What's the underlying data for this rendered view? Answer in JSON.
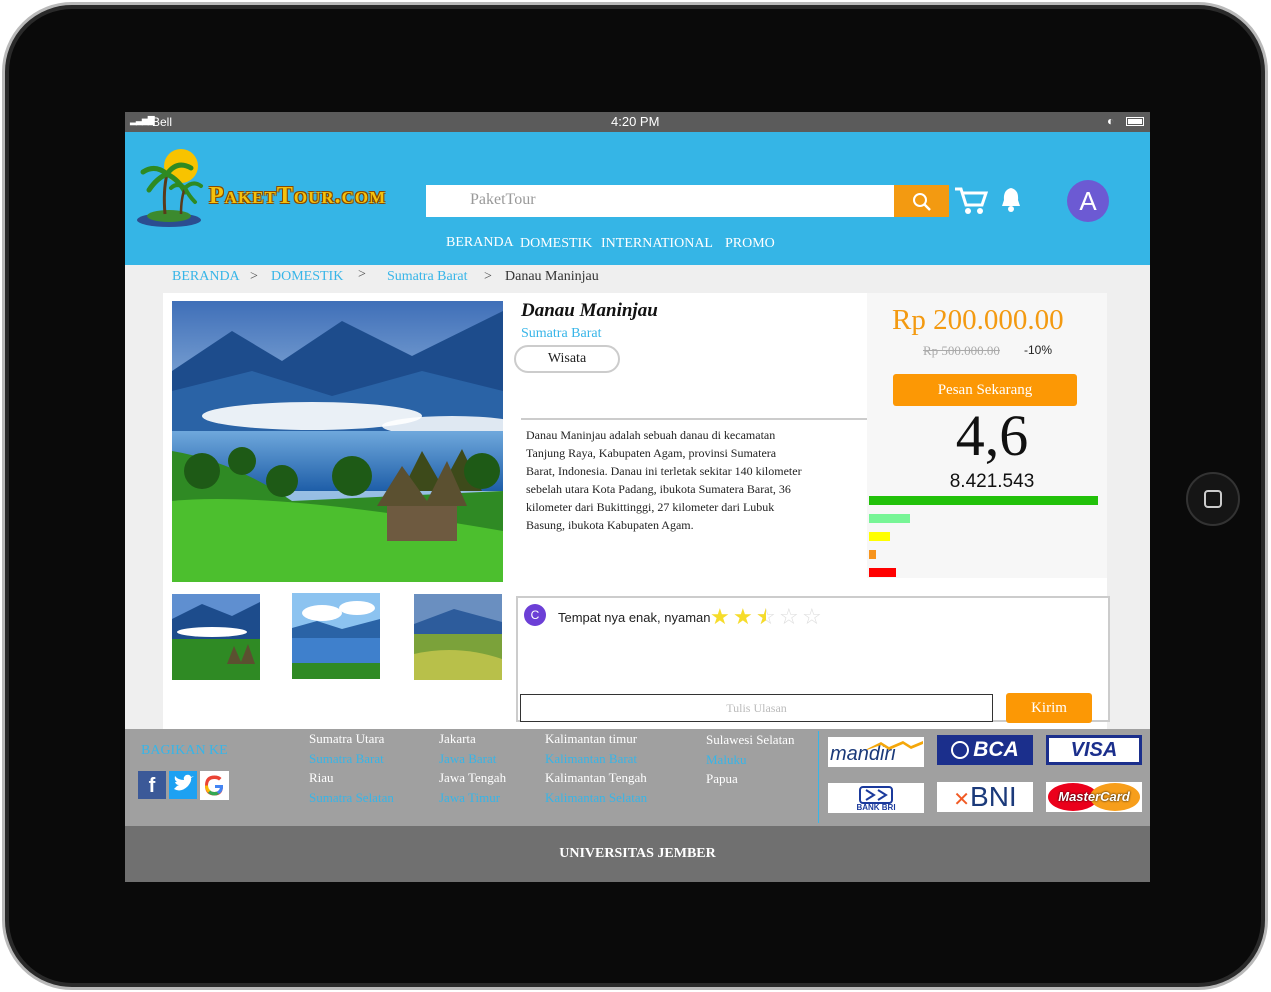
{
  "status": {
    "carrier": "Bell",
    "time": "4:20 PM"
  },
  "brand": {
    "name": "PaketTour.com"
  },
  "search": {
    "placeholder": "PaketTour"
  },
  "user": {
    "avatar_letter": "A"
  },
  "nav": [
    "BERANDA",
    "DOMESTIK",
    "INTERNATIONAL",
    "PROMO"
  ],
  "breadcrumb": [
    "BERANDA",
    ">",
    "DOMESTIK",
    ">",
    "Sumatra Barat",
    ">",
    "Danau Maninjau"
  ],
  "product": {
    "title": "Danau Maninjau",
    "region": "Sumatra Barat",
    "category": "Wisata",
    "description": "Danau Maninjau adalah sebuah danau di kecamatan Tanjung Raya, Kabupaten Agam, provinsi Sumatera Barat, Indonesia. Danau ini terletak sekitar 140 kilometer sebelah utara Kota Padang, ibukota Sumatera Barat, 36 kilometer dari Bukittinggi, 27 kilometer dari Lubuk Basung, ibukota Kabupaten Agam.",
    "price": "Rp 200.000.00",
    "old_price": "Rp 500.000.00",
    "discount": "-10%",
    "order_button": "Pesan Sekarang",
    "rating": "4,6",
    "rating_count": "8.421.543",
    "rating_bars": [
      {
        "level": 1.0,
        "color": "#22c10a"
      },
      {
        "level": 0.18,
        "color": "#77f596"
      },
      {
        "level": 0.09,
        "color": "#ffff00"
      },
      {
        "level": 0.03,
        "color": "#f7941d"
      },
      {
        "level": 0.12,
        "color": "#ff0000"
      }
    ]
  },
  "review": {
    "avatar_letter": "C",
    "text": "Tempat nya enak, nyaman",
    "stars": 2.5,
    "stars_max": 5,
    "input_placeholder": "Tulis Ulasan",
    "submit_label": "Kirim"
  },
  "footer": {
    "share_label": "BAGIKAN KE",
    "columns": [
      [
        "Sumatra Utara",
        "Sumatra Barat",
        "Riau",
        "Sumatra Selatan"
      ],
      [
        "Jakarta",
        "Jawa Barat",
        "Jawa Tengah",
        "Jawa Timur"
      ],
      [
        "Kalimantan timur",
        "Kalimantan Barat",
        "Kalimantan Tengah",
        "Kalimantan Selatan"
      ],
      [
        "Sulawesi Selatan",
        "Maluku",
        "Papua"
      ]
    ],
    "payments": [
      "mandiri",
      "BCA",
      "VISA",
      "BANK BRI",
      "BNI",
      "MasterCard"
    ],
    "university": "UNIVERSITAS JEMBER"
  },
  "colors": {
    "header": "#35b5e6",
    "accent": "#fc9805",
    "link": "#37b5e8"
  }
}
